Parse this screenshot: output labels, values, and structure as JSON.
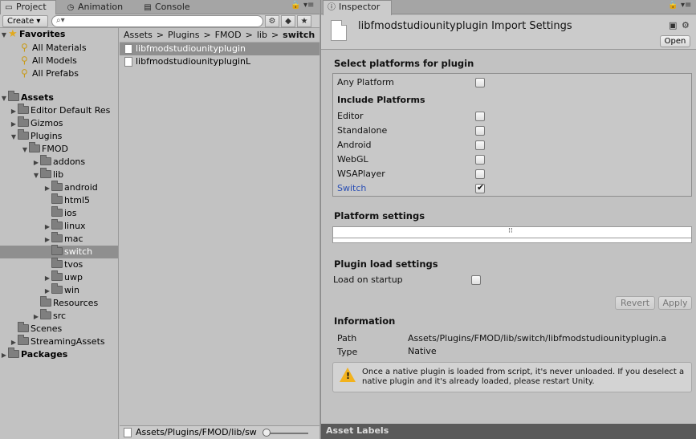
{
  "left_tabs": {
    "project": "Project",
    "animation": "Animation",
    "console": "Console"
  },
  "toolbar": {
    "create_label": "Create ▾",
    "search_placeholder": ""
  },
  "favorites": {
    "title": "Favorites",
    "items": [
      "All Materials",
      "All Models",
      "All Prefabs"
    ]
  },
  "assets_tree": {
    "assets": "Assets",
    "editor_default": "Editor Default Res",
    "gizmos": "Gizmos",
    "plugins": "Plugins",
    "fmod": "FMOD",
    "addons": "addons",
    "lib": "lib",
    "android": "android",
    "html5": "html5",
    "ios": "ios",
    "linux": "linux",
    "mac": "mac",
    "switch": "switch",
    "tvos": "tvos",
    "uwp": "uwp",
    "win": "win",
    "resources": "Resources",
    "src": "src",
    "scenes": "Scenes",
    "streaming": "StreamingAssets",
    "packages": "Packages"
  },
  "breadcrumb": [
    "Assets",
    "Plugins",
    "FMOD",
    "lib",
    "switch"
  ],
  "files": [
    "libfmodstudiounityplugin",
    "libfmodstudiounitypluginL"
  ],
  "statusbar_path": "Assets/Plugins/FMOD/lib/sw",
  "inspector": {
    "tab": "Inspector",
    "title": "libfmodstudiounityplugin Import Settings",
    "open_label": "Open",
    "select_platforms": "Select platforms for plugin",
    "any_platform": "Any Platform",
    "include_platforms": "Include Platforms",
    "platforms": [
      "Editor",
      "Standalone",
      "Android",
      "WebGL",
      "WSAPlayer",
      "Switch"
    ],
    "platform_checked": [
      false,
      false,
      false,
      false,
      false,
      true
    ],
    "platform_settings": "Platform settings",
    "plugin_load_settings": "Plugin load settings",
    "load_on_startup": "Load on startup",
    "revert": "Revert",
    "apply": "Apply",
    "information": "Information",
    "path_label": "Path",
    "path_value": "Assets/Plugins/FMOD/lib/switch/libfmodstudiounityplugin.a",
    "type_label": "Type",
    "type_value": "Native",
    "warning": "Once a native plugin is loaded from script, it's never unloaded. If you deselect a native plugin and it's already loaded, please restart Unity.",
    "asset_labels": "Asset Labels"
  }
}
